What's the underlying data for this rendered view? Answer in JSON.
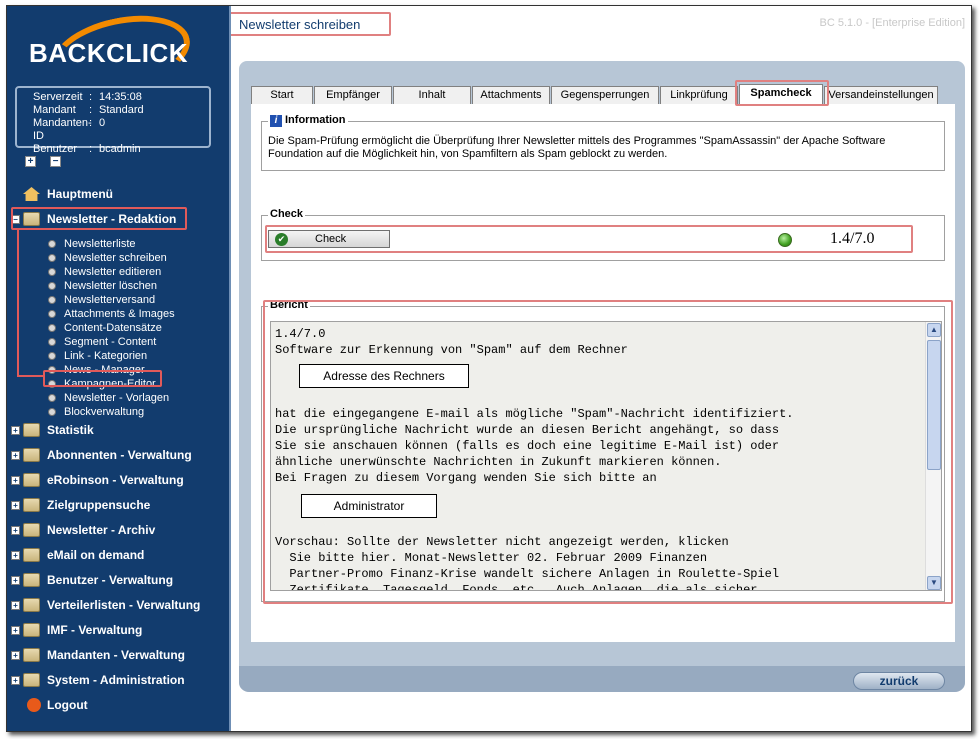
{
  "logo": {
    "text": "BACKCLICK"
  },
  "server_info": [
    {
      "key": "Serverzeit",
      "value": "14:35:08"
    },
    {
      "key": "Mandant",
      "value": "Standard"
    },
    {
      "key": "Mandanten-ID",
      "value": "0"
    },
    {
      "key": "Benutzer",
      "value": "bcadmin"
    }
  ],
  "tree_controls": {
    "expand": "+",
    "collapse": "−"
  },
  "menu": {
    "home": "Hauptmenü",
    "newsletter_redaktion": "Newsletter - Redaktion",
    "submenu": [
      "Newsletterliste",
      "Newsletter schreiben",
      "Newsletter editieren",
      "Newsletter löschen",
      "Newsletterversand",
      "Attachments & Images",
      "Content-Datensätze",
      "Segment - Content",
      "Link - Kategorien",
      "News - Manager",
      "Kampagnen-Editor",
      "Newsletter - Vorlagen",
      "Blockverwaltung"
    ],
    "sections": [
      "Statistik",
      "Abonnenten - Verwaltung",
      "eRobinson - Verwaltung",
      "Zielgruppensuche",
      "Newsletter - Archiv",
      "eMail on demand",
      "Benutzer - Verwaltung",
      "Verteilerlisten - Verwaltung",
      "IMF - Verwaltung",
      "Mandanten - Verwaltung",
      "System - Administration"
    ],
    "logout": "Logout"
  },
  "header": {
    "title": "Newsletter schreiben",
    "version": "BC 5.1.0 - [Enterprise Edition]"
  },
  "tabs": [
    "Start",
    "Empfänger",
    "Inhalt",
    "Attachments",
    "Gegensperrungen",
    "Linkprüfung",
    "Spamcheck",
    "Versandeinstellungen"
  ],
  "active_tab": "Spamcheck",
  "information": {
    "legend": "Information",
    "text": "Die Spam-Prüfung ermöglicht die Überprüfung Ihrer Newsletter mittels des Programmes \"SpamAssassin\" der Apache Software Foundation auf die Möglichkeit hin, von Spamfiltern als Spam geblockt zu werden."
  },
  "check": {
    "legend": "Check",
    "button_label": "Check",
    "score": "1.4/7.0",
    "status_color": "#40a020"
  },
  "report": {
    "legend": "Bericht",
    "lines_1": "1.4/7.0\nSoftware zur Erkennung von \"Spam\" auf dem Rechner",
    "box_1": "Adresse des Rechners",
    "lines_2": "hat die eingegangene E-mail als mögliche \"Spam\"-Nachricht identifiziert.\nDie ursprüngliche Nachricht wurde an diesen Bericht angehängt, so dass\nSie sie anschauen können (falls es doch eine legitime E-Mail ist) oder\nähnliche unerwünschte Nachrichten in Zukunft markieren können.\nBei Fragen zu diesem Vorgang wenden Sie sich bitte an",
    "box_2": "Administrator",
    "lines_3": "Vorschau: Sollte der Newsletter nicht angezeigt werden, klicken\n  Sie bitte hier. Monat-Newsletter 02. Februar 2009 Finanzen\n  Partner-Promo Finanz-Krise wandelt sichere Anlagen in Roulette-Spiel\n  Zertifikate, Tagesgeld, Fonds, etc.. Auch Anlagen, die als sicher"
  },
  "footer": {
    "back_label": "zurück"
  },
  "colors": {
    "sidebar": "#123c6e",
    "accent": "#f28a00",
    "highlight": "#e05a5a"
  }
}
